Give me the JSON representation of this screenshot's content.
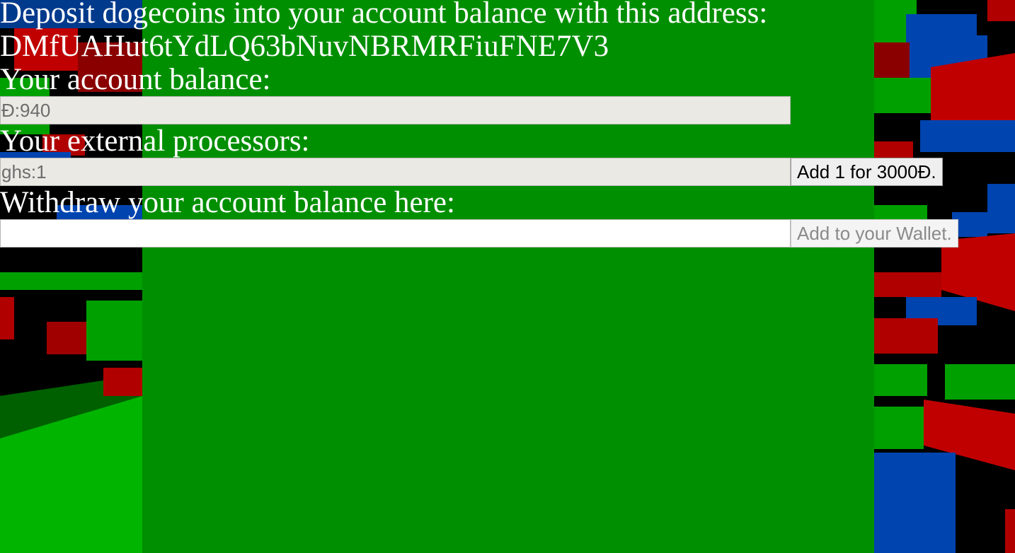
{
  "colors": {
    "panel": "#008f00",
    "text": "#ffffff",
    "field_readonly": "#ebe9e4",
    "field_empty": "#ffffff",
    "block_red": "#b00000",
    "block_green": "#00a000",
    "block_blue": "#0040b0"
  },
  "deposit": {
    "heading": "Deposit dogecoins into your account balance with this address:",
    "address": "DMfUAHut6tYdLQ63bNuvNBRMRFiuFNE7V3"
  },
  "balance": {
    "label": "Your account balance:",
    "value": "Đ:940"
  },
  "processors": {
    "label": "Your external processors:",
    "value": "ghs:1",
    "add_button": "Add 1 for 3000Đ."
  },
  "withdraw": {
    "label": "Withdraw your account balance here:",
    "value": "",
    "button": "Add to your Wallet."
  }
}
